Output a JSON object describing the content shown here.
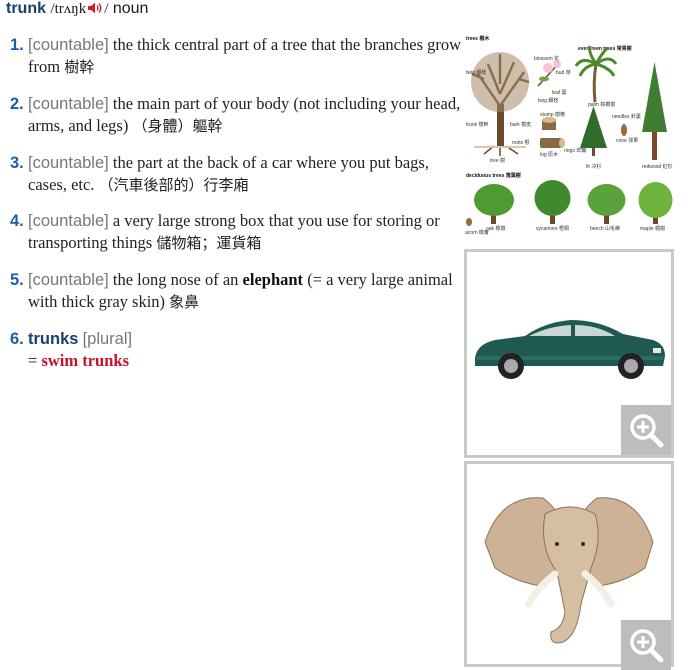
{
  "entry": {
    "headword": "trunk",
    "pron_open": "/",
    "pron": "trʌŋk",
    "pron_close": "/",
    "pos": "noun"
  },
  "senses": [
    {
      "num": "1.",
      "gram": "[countable]",
      "def": "the thick central part of a tree that the branches grow from",
      "zh": "樹幹"
    },
    {
      "num": "2.",
      "gram": "[countable]",
      "def": "the main part of your body (not including your head, arms, and legs)",
      "zh": "（身體）軀幹"
    },
    {
      "num": "3.",
      "gram": "[countable]",
      "def": "the part at the back of a car where you put bags, cases, etc.",
      "zh": "（汽車後部的）行李廂"
    },
    {
      "num": "4.",
      "gram": "[countable]",
      "def": "a very large strong box that you use for storing or transporting things",
      "zh": "儲物箱；運貨箱"
    },
    {
      "num": "5.",
      "gram": "[countable]",
      "def_pre": "the long nose of an",
      "keyword": "elephant",
      "def_post": "(= a very large animal with thick gray skin)",
      "zh": "象鼻"
    },
    {
      "num": "6.",
      "phrase": "trunks",
      "gram": "[plural]",
      "eq": "=",
      "xref": "swim trunks"
    }
  ],
  "trees_illustration": {
    "labels": {
      "trees": "trees 樹木",
      "evergreen": "evergreen trees 常青樹",
      "deciduous": "deciduous trees 落葉樹",
      "blossom": "blossom 花",
      "bud": "bud 芽",
      "leaf": "leaf 葉",
      "twig": "twig 細枝",
      "branch": "branch 樹枝",
      "trunk": "trunk 樹幹",
      "bark": "bark 樹皮",
      "roots": "roots 根",
      "tree": "tree 樹",
      "stump": "stump 樹樁",
      "log": "log 原木",
      "rings": "rings 年輪",
      "palm": "palm 棕櫚樹",
      "fir": "fir 冷杉",
      "cone": "cone 球果",
      "needles": "needles 針葉",
      "redwood": "redwood 紅杉",
      "oak": "oak 橡樹",
      "sycamore": "sycamore 梧桐",
      "beech": "beech 山毛櫸",
      "maple": "maple 楓樹",
      "acorn": "acorn 橡實"
    }
  },
  "colors": {
    "number": "#1d5ea8",
    "grammar": "#777777",
    "xref": "#c8102e",
    "headword": "#1b3f6b",
    "speaker": "#d0202e"
  }
}
